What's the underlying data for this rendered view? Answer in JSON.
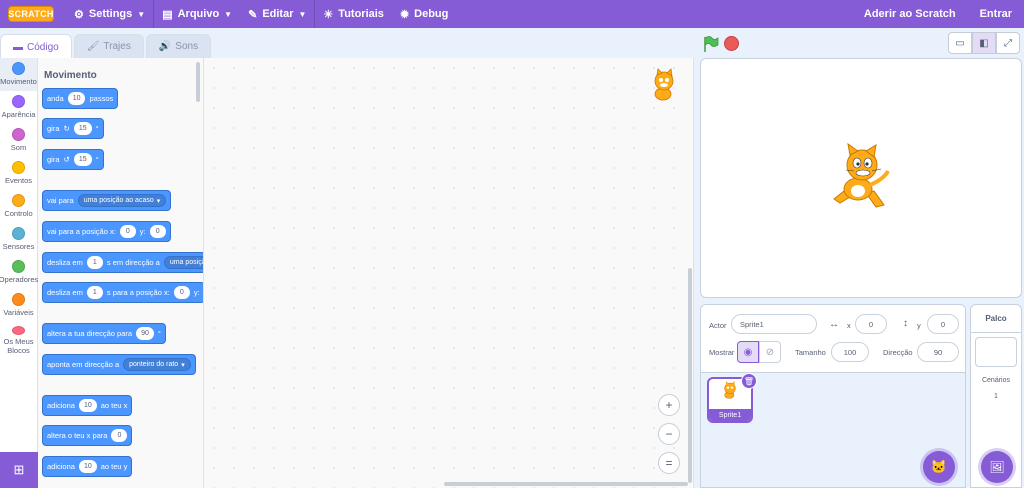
{
  "menubar": {
    "logo": "SCRATCH",
    "settings": "Settings",
    "file": "Arquivo",
    "edit": "Editar",
    "tutorials": "Tutoriais",
    "debug": "Debug",
    "join": "Aderir ao Scratch",
    "signin": "Entrar"
  },
  "tabs": {
    "code": "Código",
    "costumes": "Trajes",
    "sounds": "Sons"
  },
  "categories": [
    {
      "label": "Movimento",
      "color": "#4c97ff"
    },
    {
      "label": "Aparência",
      "color": "#9966ff"
    },
    {
      "label": "Som",
      "color": "#cf63cf"
    },
    {
      "label": "Eventos",
      "color": "#ffbf00"
    },
    {
      "label": "Controlo",
      "color": "#ffab19"
    },
    {
      "label": "Sensores",
      "color": "#5cb1d6"
    },
    {
      "label": "Operadores",
      "color": "#59c059"
    },
    {
      "label": "Variáveis",
      "color": "#ff8c1a"
    },
    {
      "label": "Os Meus Blocos",
      "color": "#ff6680"
    }
  ],
  "palette": {
    "title": "Movimento",
    "move": {
      "a": "anda",
      "v": "10",
      "b": "passos"
    },
    "turn_right": {
      "a": "gira",
      "v": "15",
      "b": "°"
    },
    "turn_left": {
      "a": "gira",
      "v": "15",
      "b": "°"
    },
    "goto": {
      "a": "vai para",
      "dd": "uma posição ao acaso"
    },
    "goto_xy": {
      "a": "vai para a posição x:",
      "x": "0",
      "b": "y:",
      "y": "0"
    },
    "glide_to": {
      "a": "desliza em",
      "v": "1",
      "b": "s em direcção a",
      "dd": "uma posição"
    },
    "glide_xy": {
      "a": "desliza em",
      "v": "1",
      "b": "s para a posição x:",
      "x": "0",
      "c": "y:"
    },
    "point_dir": {
      "a": "altera a tua direcção para",
      "v": "90",
      "b": "°"
    },
    "point_towards": {
      "a": "aponta em direcção a",
      "dd": "ponteiro do rato"
    },
    "change_x": {
      "a": "adiciona",
      "v": "10",
      "b": "ao teu x"
    },
    "set_x": {
      "a": "altera o teu x para",
      "v": "0"
    },
    "change_y": {
      "a": "adiciona",
      "v": "10",
      "b": "ao teu y"
    }
  },
  "zoom": {
    "in": "+",
    "out": "−",
    "reset": "="
  },
  "sprite_info": {
    "sprite_label": "Actor",
    "sprite_name": "Sprite1",
    "x_label": "x",
    "x_value": "0",
    "y_label": "y",
    "y_value": "0",
    "show_label": "Mostrar",
    "size_label": "Tamanho",
    "size_value": "100",
    "direction_label": "Direcção",
    "direction_value": "90"
  },
  "sprites": [
    {
      "name": "Sprite1"
    }
  ],
  "stage_pane": {
    "title": "Palco",
    "backdrops_label": "Cenários",
    "backdrops_count": "1"
  }
}
